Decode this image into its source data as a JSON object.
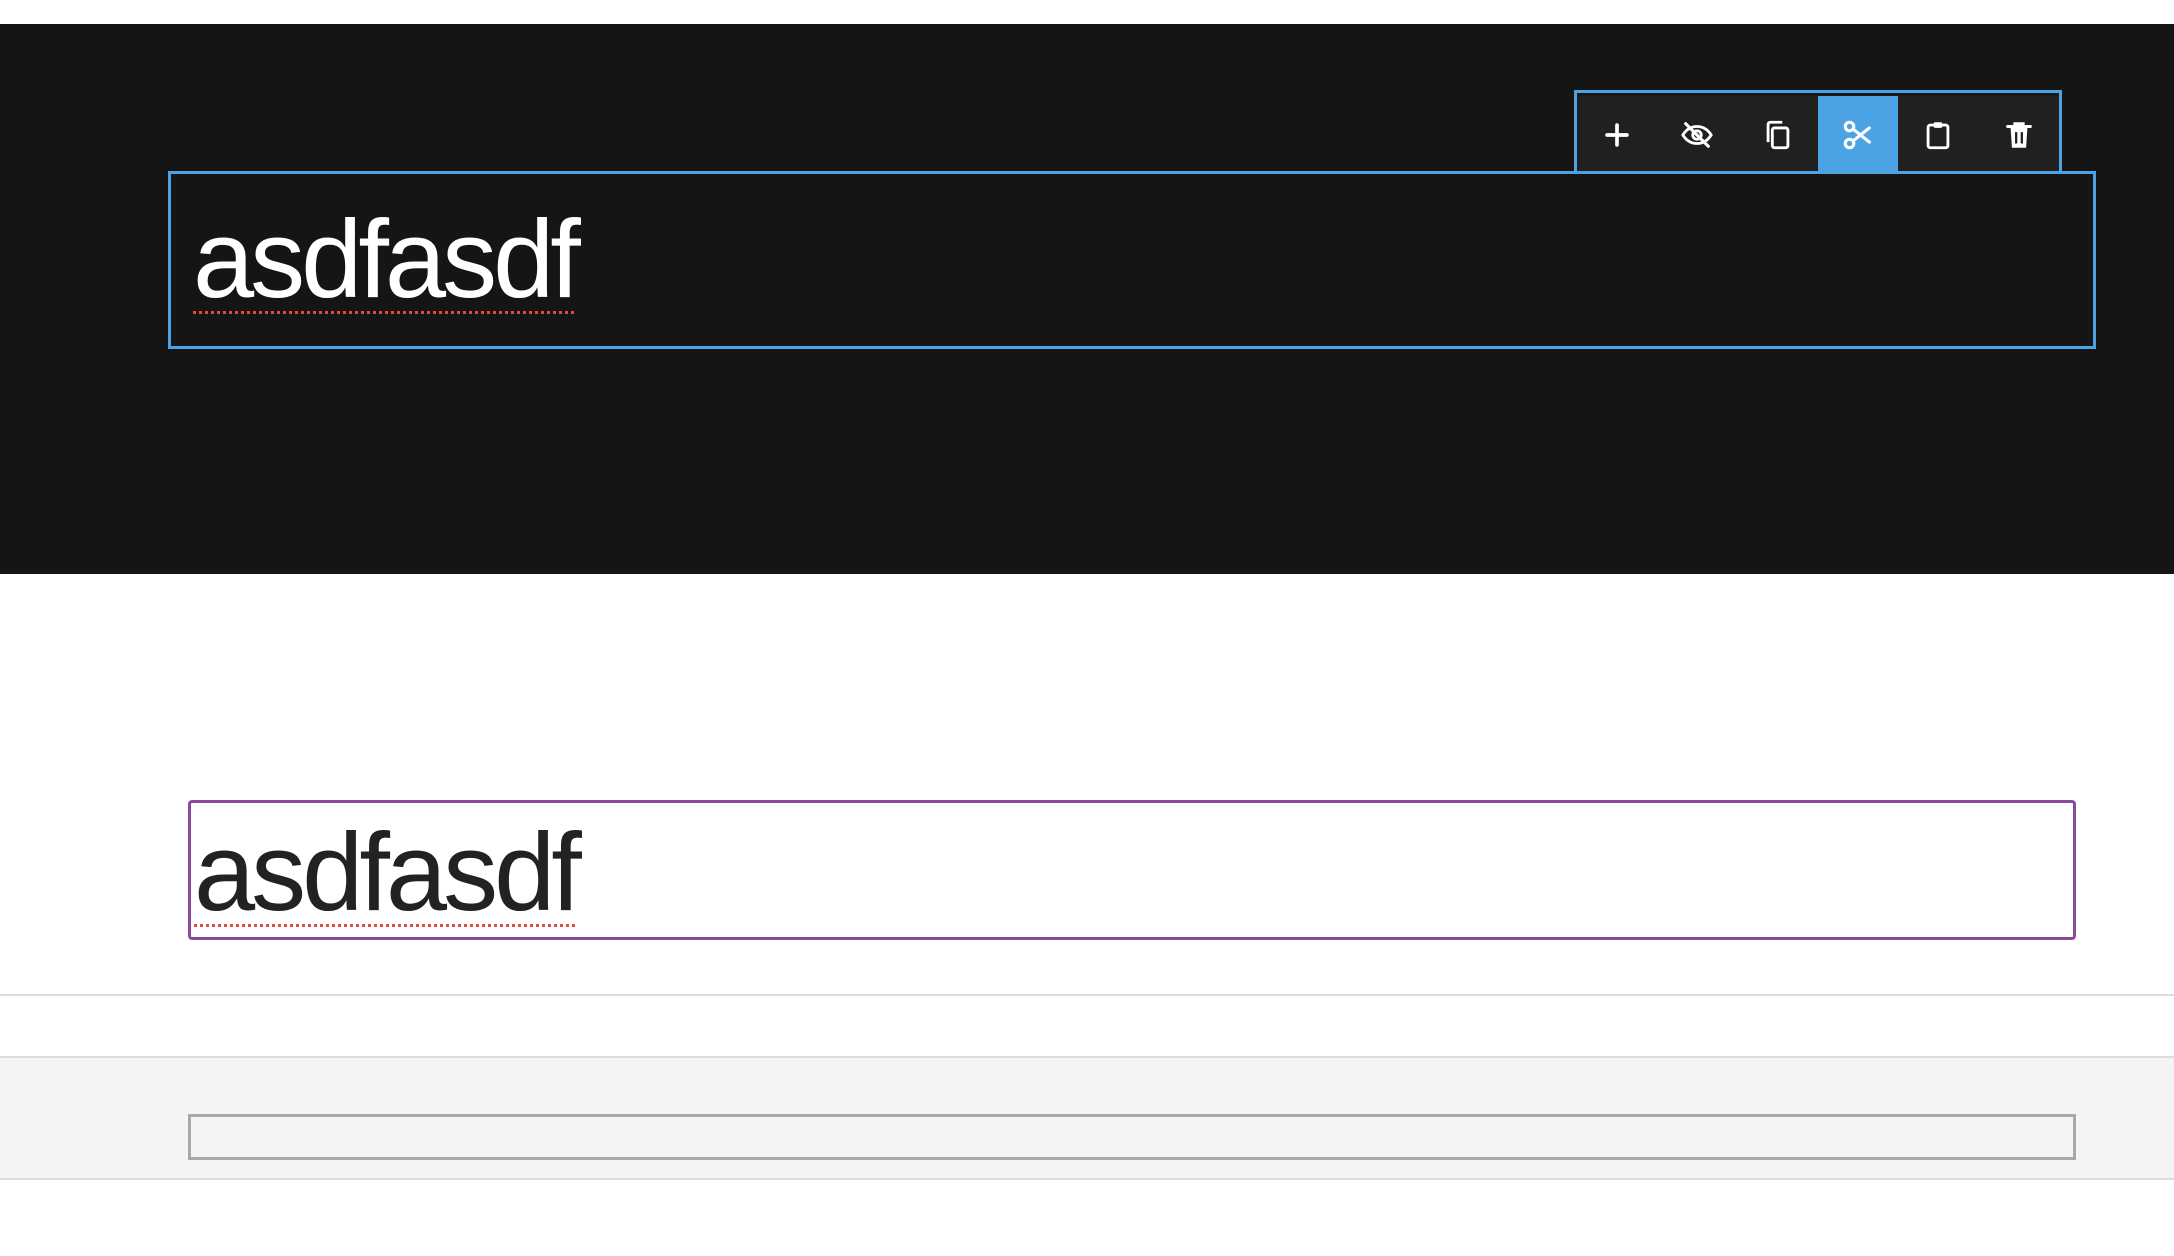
{
  "canvas": {
    "dark_section": {
      "heading": {
        "text": "asdfasdf"
      },
      "toolbar": {
        "buttons": [
          {
            "icon": "plus-icon",
            "active": false
          },
          {
            "icon": "eye-off-icon",
            "active": false
          },
          {
            "icon": "copy-icon",
            "active": false
          },
          {
            "icon": "scissors-icon",
            "active": true
          },
          {
            "icon": "clipboard-icon",
            "active": false
          },
          {
            "icon": "trash-icon",
            "active": false
          }
        ]
      }
    },
    "light_section": {
      "heading": {
        "text": "asdfasdf"
      }
    },
    "grey_section": {
      "field": {
        "value": ""
      }
    }
  },
  "colors": {
    "selection_blue": "#4ba3e3",
    "hover_purple": "#8a4a9a",
    "dark_background": "#151515",
    "spellcheck_red": "#e34c3c"
  }
}
